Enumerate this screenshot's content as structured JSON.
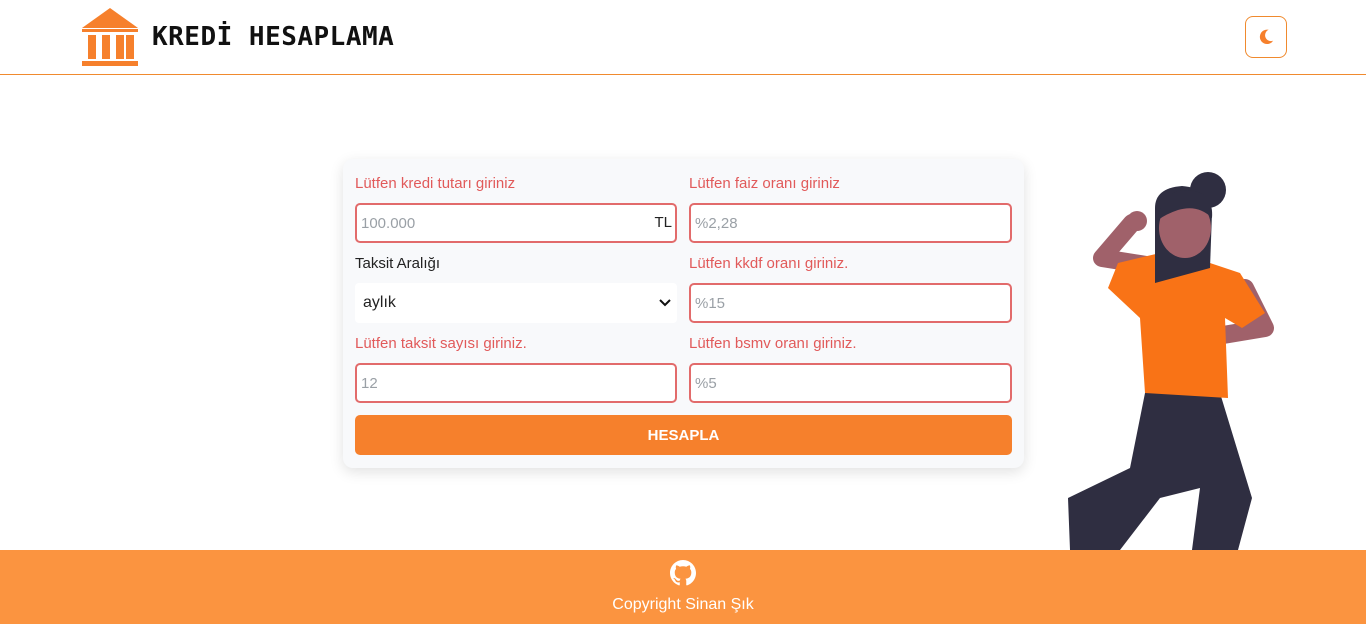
{
  "header": {
    "title": "KREDİ HESAPLAMA",
    "logo_icon": "bank-icon",
    "theme_toggle_icon": "moon-icon",
    "accent_color": "#f6802c"
  },
  "form": {
    "loan_amount": {
      "label": "Lütfen kredi tutarı giriniz",
      "placeholder": "100.000",
      "suffix": "TL"
    },
    "interest_rate": {
      "label": "Lütfen faiz oranı giriniz",
      "placeholder": "%2,28"
    },
    "installment_interval": {
      "label": "Taksit Aralığı",
      "selected": "aylık"
    },
    "kkdf_rate": {
      "label": "Lütfen kkdf oranı giriniz.",
      "placeholder": "%15"
    },
    "installment_count": {
      "label": "Lütfen taksit sayısı giriniz.",
      "placeholder": "12"
    },
    "bsmv_rate": {
      "label": "Lütfen bsmv oranı giriniz.",
      "placeholder": "%5"
    },
    "submit_label": "HESAPLA"
  },
  "footer": {
    "github_icon": "github-icon",
    "copyright": "Copyright Sinan Şık",
    "background_color": "#fb9440"
  }
}
